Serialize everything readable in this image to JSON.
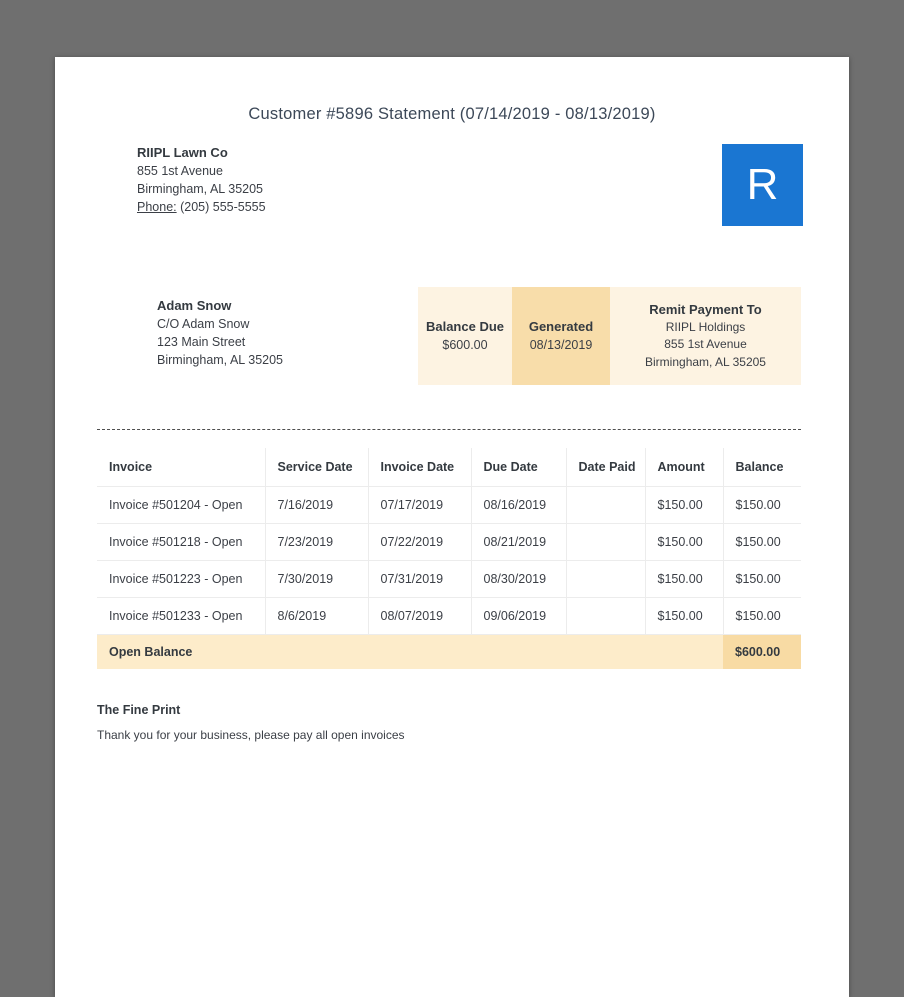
{
  "header": {
    "title": "Customer #5896 Statement (07/14/2019 - 08/13/2019)"
  },
  "company": {
    "name": "RIIPL Lawn Co",
    "address_line1": "855 1st Avenue",
    "address_line2": "Birmingham, AL 35205",
    "phone_label": "Phone:",
    "phone_number": "(205) 555-5555",
    "logo_letter": "R",
    "logo_color": "#1a76d2"
  },
  "customer": {
    "name": "Adam Snow",
    "care_of": "C/O Adam Snow",
    "address_line1": "123 Main Street",
    "address_line2": "Birmingham, AL 35205"
  },
  "summary": {
    "balance_due": {
      "label": "Balance Due",
      "value": "$600.00"
    },
    "generated": {
      "label": "Generated",
      "value": "08/13/2019"
    },
    "remit": {
      "label": "Remit Payment To",
      "name": "RIIPL Holdings",
      "address_line1": "855 1st Avenue",
      "address_line2": "Birmingham, AL 35205"
    }
  },
  "table": {
    "headers": [
      "Invoice",
      "Service Date",
      "Invoice Date",
      "Due Date",
      "Date Paid",
      "Amount",
      "Balance"
    ],
    "rows": [
      [
        "Invoice #501204 - Open",
        "7/16/2019",
        "07/17/2019",
        "08/16/2019",
        "",
        "$150.00",
        "$150.00"
      ],
      [
        "Invoice #501218 - Open",
        "7/23/2019",
        "07/22/2019",
        "08/21/2019",
        "",
        "$150.00",
        "$150.00"
      ],
      [
        "Invoice #501223 - Open",
        "7/30/2019",
        "07/31/2019",
        "08/30/2019",
        "",
        "$150.00",
        "$150.00"
      ],
      [
        "Invoice #501233 - Open",
        "8/6/2019",
        "08/07/2019",
        "09/06/2019",
        "",
        "$150.00",
        "$150.00"
      ]
    ],
    "footer": {
      "label": "Open Balance",
      "balance": "$600.00"
    }
  },
  "fine_print": {
    "title": "The Fine Print",
    "text": "Thank you for your business, please pay all open invoices"
  },
  "colors": {
    "viewer_background": "#6f6f6f",
    "logo_blue": "#1a76d2",
    "cream_light": "#fdf3e2",
    "cream_dark": "#f8ddaa",
    "open_balance_row": "#fdecca",
    "open_balance_cell": "#f8dba4"
  }
}
